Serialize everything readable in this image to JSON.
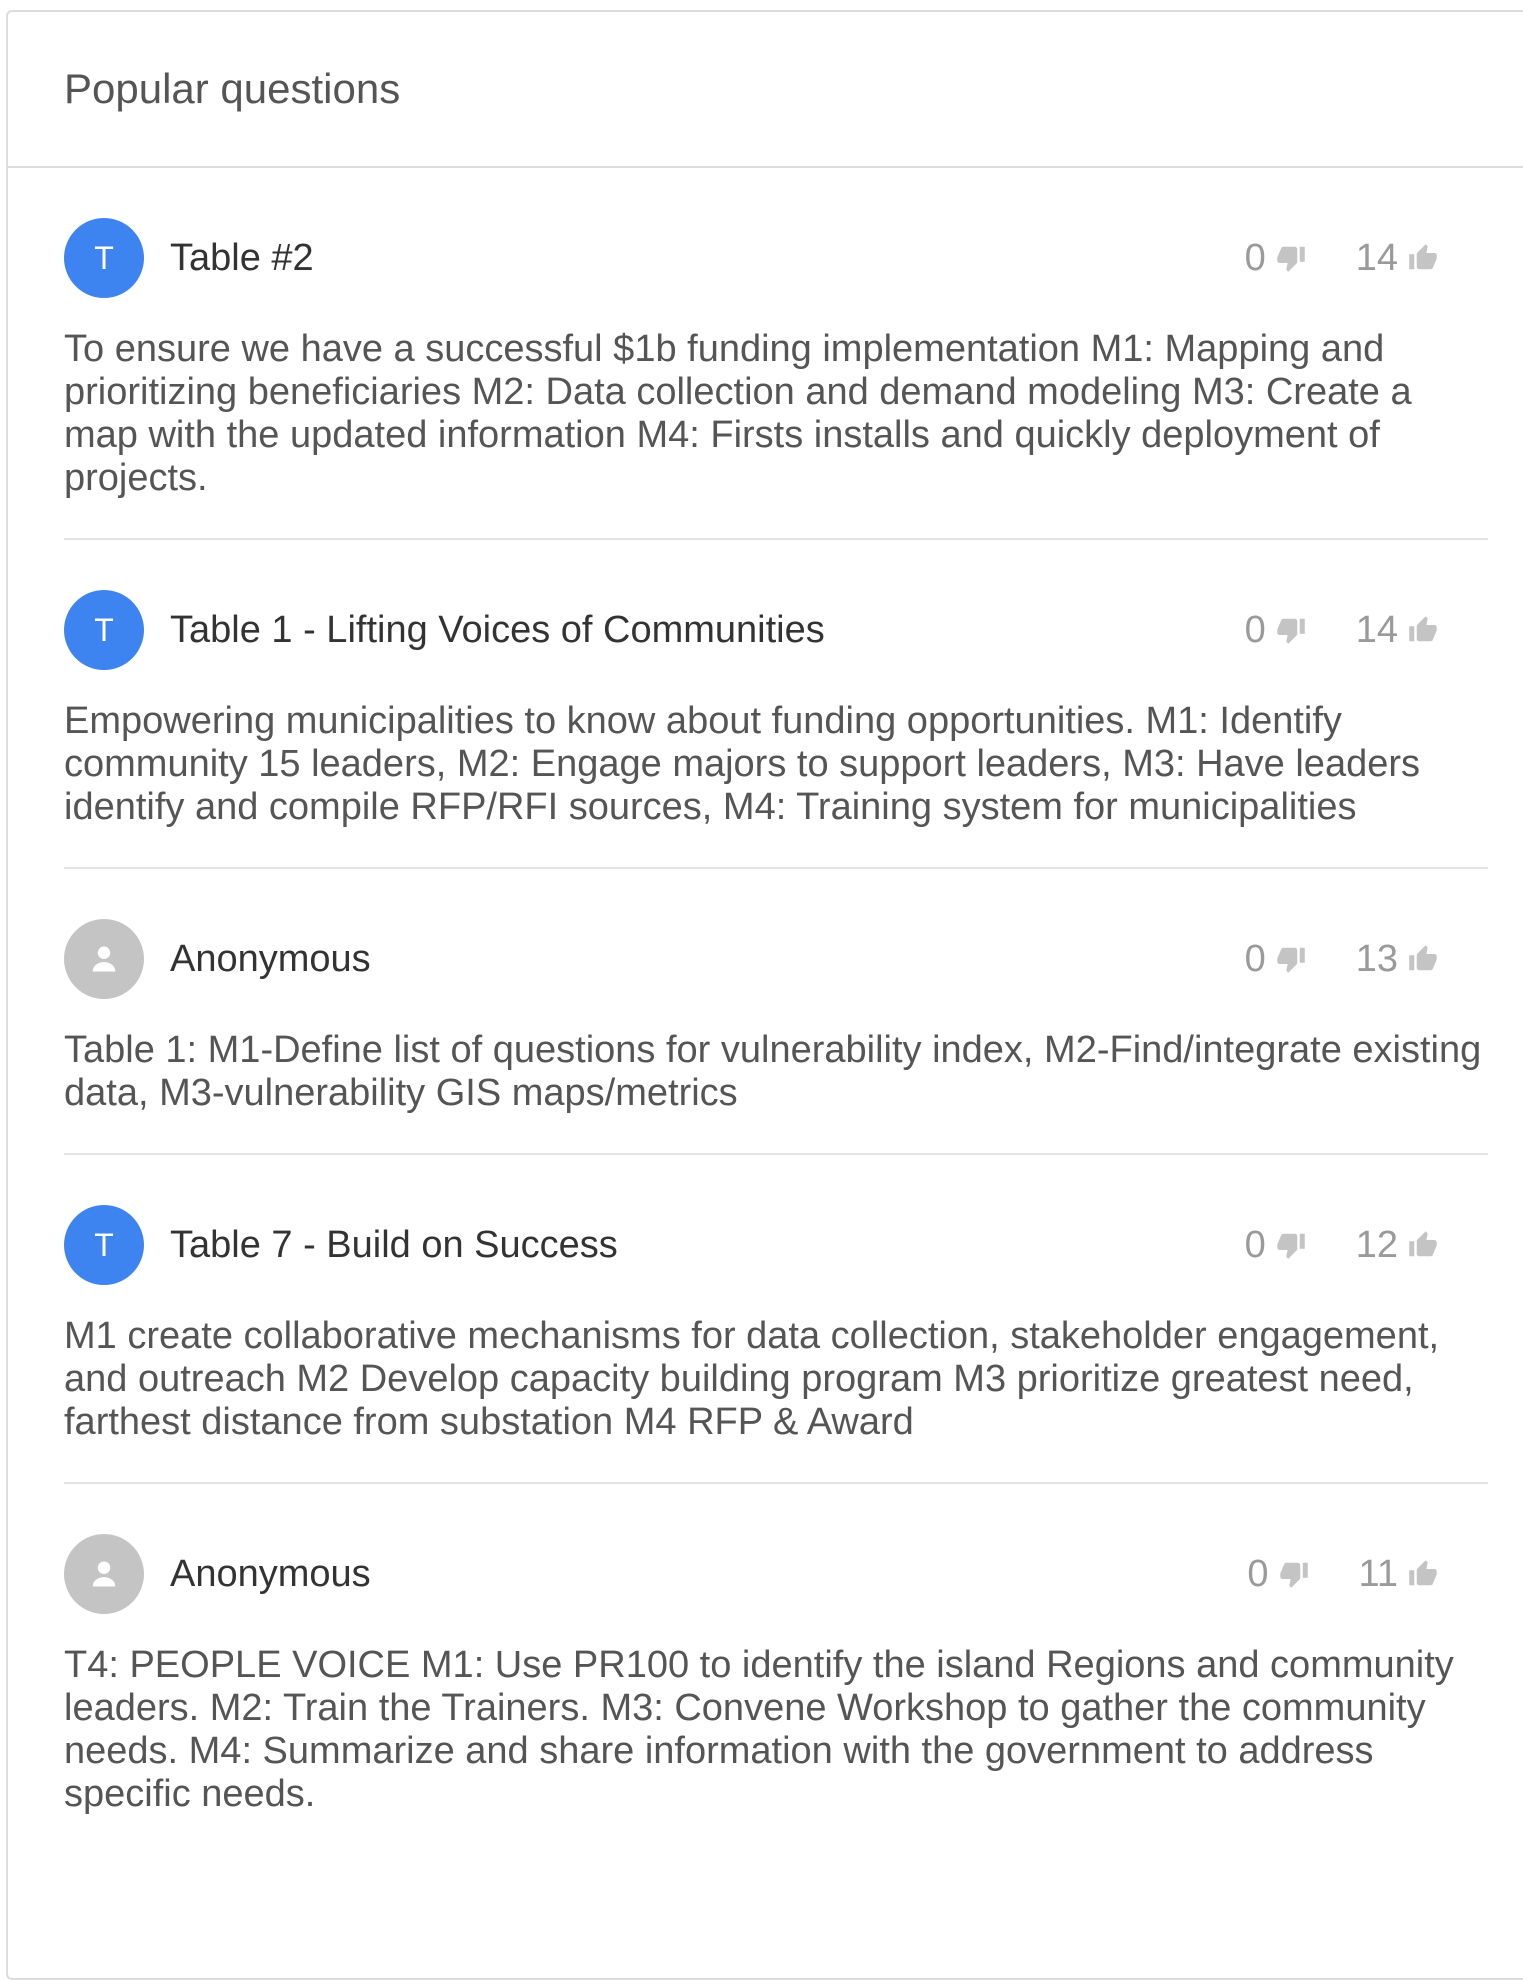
{
  "header": {
    "title": "Popular questions"
  },
  "questions": [
    {
      "avatar_letter": "T",
      "author": "Table #2",
      "downvotes": "0",
      "upvotes": "14",
      "text": "To ensure we have a successful $1b funding implementation M1: Mapping and prioritizing beneficiaries M2: Data collection and demand modeling M3: Create a map with the updated information M4: Firsts installs and quickly deployment of projects."
    },
    {
      "avatar_letter": "T",
      "author": "Table 1 - Lifting Voices of Communities",
      "downvotes": "0",
      "upvotes": "14",
      "text": "Empowering municipalities to know about funding opportunities. M1: Identify community 15 leaders, M2: Engage majors to support leaders, M3: Have leaders identify and compile RFP/RFI sources, M4: Training system for municipalities"
    },
    {
      "avatar_letter": "",
      "author": "Anonymous",
      "downvotes": "0",
      "upvotes": "13",
      "text": "Table 1: M1-Define list of questions for vulnerability index, M2-Find/integrate existing data, M3-vulnerability GIS maps/metrics"
    },
    {
      "avatar_letter": "T",
      "author": "Table 7 - Build on Success",
      "downvotes": "0",
      "upvotes": "12",
      "text": "M1 create collaborative mechanisms for data collection, stakeholder engagement, and outreach M2 Develop capacity building program M3 prioritize greatest need, farthest distance from substation M4 RFP & Award"
    },
    {
      "avatar_letter": "",
      "author": "Anonymous",
      "downvotes": "0",
      "upvotes": "11",
      "text": "T4: PEOPLE VOICE M1: Use PR100 to identify the island Regions and community leaders. M2: Train the Trainers. M3: Convene Workshop to gather the community needs. M4: Summarize and share information with the government to address specific needs."
    }
  ],
  "icons": {
    "downvote": "thumbs-down-icon",
    "upvote": "thumbs-up-icon",
    "anonymous": "person-icon"
  },
  "colors": {
    "avatar_letter": "#3d84f0",
    "avatar_anonymous": "#c4c4c4",
    "vote_text": "#9a9a9a"
  }
}
